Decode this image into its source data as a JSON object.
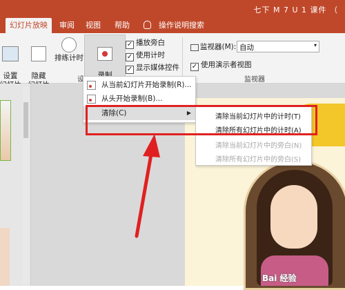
{
  "window": {
    "title": "七下 M 7 U 1 课件 （"
  },
  "tabs": [
    "幻灯片放映",
    "审阅",
    "视图",
    "帮助",
    "操作说明搜索"
  ],
  "ribbon": {
    "setup_slideshow": "设置\n幻灯片放映",
    "hide_slide": "隐藏\n幻灯片",
    "rehearse_timings": "排练计时",
    "record_slideshow": "录制\n幻灯片演示",
    "play_narrations": "播放旁白",
    "use_timings": "使用计时",
    "show_media_controls": "显示媒体控件",
    "monitor_label": "监视器(M):",
    "monitor_value": "自动",
    "presenter_view": "使用演示者视图",
    "group_setup_fragment": "设",
    "group_monitors": "监视器"
  },
  "record_menu": {
    "from_current": "从当前幻灯片开始录制(R)...",
    "from_beginning": "从头开始录制(B)...",
    "clear": "清除(C)"
  },
  "clear_submenu": {
    "clear_timing_current": "清除当前幻灯片中的计时(T)",
    "clear_timing_all": "清除所有幻灯片中的计时(A)",
    "clear_narration_current": "清除当前幻灯片中的旁白(N)",
    "clear_narration_all": "清除所有幻灯片中的旁白(S)"
  },
  "watermark": "Bai 经验",
  "colors": {
    "accent": "#c0482a",
    "annotation": "#e02020"
  }
}
